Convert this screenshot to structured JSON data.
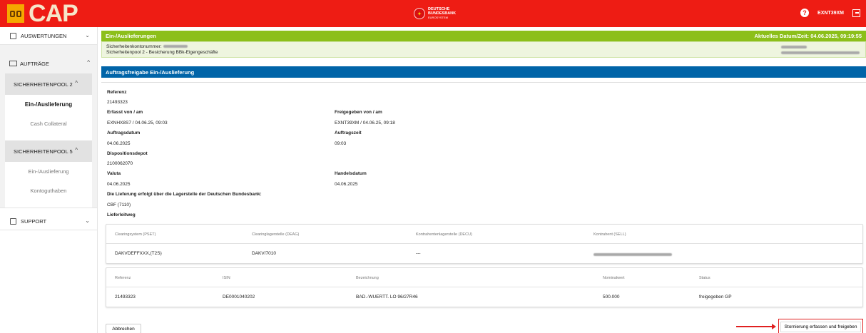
{
  "header": {
    "app_name": "CAP",
    "bank_line1": "DEUTSCHE",
    "bank_line2": "BUNDESBANK",
    "bank_line3": "EUROSYSTEM",
    "help": "?",
    "user": "EXNT39XM"
  },
  "sidebar": {
    "auswertungen": "AUSWERTUNGEN",
    "auftraege": "AUFTRÄGE",
    "pool2": "SICHERHEITENPOOL 2",
    "pool2_items": [
      "Ein-/Auslieferung",
      "Cash Collateral"
    ],
    "pool5": "SICHERHEITENPOOL 5",
    "pool5_items": [
      "Ein-/Auslieferung",
      "Kontoguthaben"
    ],
    "support": "SUPPORT",
    "chev_up": "^",
    "chev_down": "⌄"
  },
  "main": {
    "section_title": "Ein-/Auslieferungen",
    "current_datetime": "Aktuelles Datum/Zeit: 04.06.2025, 09:19:55",
    "account_label": "Sicherheitenkontonummer:",
    "pool_line": "Sicherheitenpool 2 - Besicherung BBk-Eigengeschäfte",
    "subsection_title": "Auftragsfreigabe Ein-/Auslieferung",
    "fields": {
      "referenz_label": "Referenz",
      "referenz_value": "21493323",
      "erfasst_label": "Erfasst von / am",
      "erfasst_value": "EXNHX8S7 / 04.06.25, 09:03",
      "freigegeben_label": "Freigegeben von / am",
      "freigegeben_value": "EXNT39XM / 04.06.25, 09:18",
      "auftragsdatum_label": "Auftragsdatum",
      "auftragsdatum_value": "04.06.2025",
      "auftragszeit_label": "Auftragszeit",
      "auftragszeit_value": "09:03",
      "depot_label": "Dispositionsdepot",
      "depot_value": "2100062070",
      "valuta_label": "Valuta",
      "valuta_value": "04.06.2025",
      "handelsdatum_label": "Handelsdatum",
      "handelsdatum_value": "04.06.2025",
      "lieferung_label": "Die Lieferung erfolgt über die Lagerstelle der Deutschen Bundesbank:",
      "lieferung_value": "CBF (7110)",
      "lieferleitweg_label": "Lieferleitweg"
    },
    "route_table": {
      "headers": [
        "Clearingsystem (PSET)",
        "Clearinglagerstelle (DEAG)",
        "Kontrahentenlagerstelle (DECU)",
        "Kontrahent (SELL)"
      ],
      "row": [
        "DAKVDEFFXXX,(T2S)",
        "DAKV/7010",
        "---"
      ]
    },
    "position_table": {
      "headers": [
        "Referenz",
        "ISIN",
        "Bezeichnung",
        "Nominalwert",
        "Status"
      ],
      "row": [
        "21493323",
        "DE0001040202",
        "BAD.-WUERTT. LO 96/27R46",
        "500.000",
        "freigegeben GP"
      ]
    },
    "cancel_button": "Abbrechen",
    "submit_button": "Stornierung erfassen und freigeben"
  }
}
